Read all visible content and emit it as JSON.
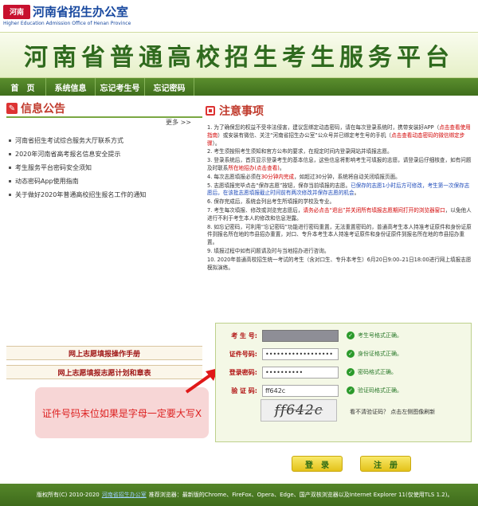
{
  "header": {
    "logo_seal": "河南",
    "logo_cn": "河南省招生办公室",
    "logo_en": "Higher Education Admission Office of Henan Province",
    "banner_title": "河南省普通高校招生考生服务平台"
  },
  "nav": {
    "items": [
      {
        "label": "首　页"
      },
      {
        "label": "系统信息"
      },
      {
        "label": "忘记考生号"
      },
      {
        "label": "忘记密码"
      }
    ]
  },
  "info": {
    "title": "信息公告",
    "more": "更多 >>",
    "items": [
      {
        "text": "河南省招生考试综合服务大厅联系方式"
      },
      {
        "text": "2020年河南省高考报名信息安全提示"
      },
      {
        "text": "考生服务平台密码安全须知"
      },
      {
        "text": "动态密码App使用指南"
      },
      {
        "text": "关于做好2020年普通高校招生报名工作的通知"
      }
    ],
    "guides": [
      {
        "label": "网上志愿填报操作手册"
      },
      {
        "label": "网上志愿填报志愿计划和章表"
      }
    ]
  },
  "callout": {
    "text": "证件号码末位如果是字母一定要大写X"
  },
  "notes": {
    "title": "注意事项",
    "items": [
      {
        "a": "1. 为了确保您的权益不受非法侵害，建议您绑定动态密码，请在每次登录系统时，携带安装好APP（",
        "r": "点击查看使用指南",
        "b": "）或安装有微信、关注“河南省招生办公室”公众号并已绑定考生号的手机（",
        "r2": "点击查看动态密码的微信绑定步骤",
        "c": "）。"
      },
      {
        "a": "2. 考生须按照考生须知和官方公布的要求，在规定时间内登录网站并填报志愿。",
        "r": "",
        "b": "",
        "r2": "",
        "c": ""
      },
      {
        "a": "3. 登录系统后，首页显示登录考生的基本信息，这些信息将影响考生可填报的志愿，请登录后仔细核查，如有问题及时联系",
        "r": "所在地招办(点击查看)",
        "b": "。",
        "r2": "",
        "c": ""
      },
      {
        "a": "4. 每次志愿填报必须在",
        "r": "30分钟内完成",
        "b": "，如超过30分钟，系统将自动关闭填报页面。",
        "r2": "",
        "c": ""
      },
      {
        "a": "5. 志愿填报完毕点击“保存志愿”按钮，保存当前填报的志愿。",
        "r": "已保存的志愿1小时后方可修改，考生第一次保存志愿后，在该批志愿填报截止时间前有两次修改并保存志愿的机会",
        "b": "。",
        "r2": "",
        "c": ""
      },
      {
        "a": "6. 保存完成后，系统会列出考生所填报的学校及专业。",
        "r": "",
        "b": "",
        "r2": "",
        "c": ""
      },
      {
        "a": "7. 考生每次填报、修改或浏览完志愿后，",
        "r": "请务必点击“退出”并关闭所有填报志愿期间打开的浏览器窗口",
        "b": "，以免他人进行不利于考生本人的修改和信息泄露。",
        "r2": "",
        "c": ""
      },
      {
        "a": "8. 如忘记密码，可利用“忘记密码”功能进行密码重置，无法重置密码的，普通高考生本人持准考证原件和身份证原件到报名所在地的市县招办重置，对口、专升本考生本人持准考证原件和身份证原件到报名所在地的市县招办重置。",
        "r": "",
        "b": "",
        "r2": "",
        "c": ""
      },
      {
        "a": "9. 填报过程中如有问题请及时与当地招办进行咨询。",
        "r": "",
        "b": "",
        "r2": "",
        "c": ""
      },
      {
        "a": "10. 2020年普通高校招生统一考试的考生（含对口生、专升本考生）6月20日9:00–21日18:00进行网上填报志愿模拟演练。",
        "r": "",
        "b": "",
        "r2": "",
        "c": ""
      }
    ]
  },
  "login": {
    "rows": [
      {
        "label": "考 生 号:",
        "value": "",
        "msg": "考生号格式正确。"
      },
      {
        "label": "证件号码:",
        "value": "••••••••••••••••••",
        "msg": "身份证格式正确。"
      },
      {
        "label": "登录密码:",
        "value": "••••••••••",
        "msg": "密码格式正确。"
      },
      {
        "label": "验 证 码:",
        "value": "ff642c",
        "msg": "验证码格式正确。"
      }
    ],
    "captcha_text": "ff642c",
    "captcha_hint": "看不清验证码？ 点击左侧图像刷新",
    "login_button": "登　录",
    "register_button": "注　册"
  },
  "footer": {
    "copyright": "版权所有(C) 2010-2020",
    "link": "河南省招生办公室",
    "recommend": "推荐浏览器：最新版的Chrome、FireFox、Opera、Edge、国产双核浏览器以及Internet Explorer 11(仅使用TLS 1.2)。"
  },
  "colors": {
    "brand_green": "#3f6e1c",
    "banner_text": "#2f6a1e",
    "alert_red": "#d20000",
    "button_yellow": "#e3c21a"
  }
}
